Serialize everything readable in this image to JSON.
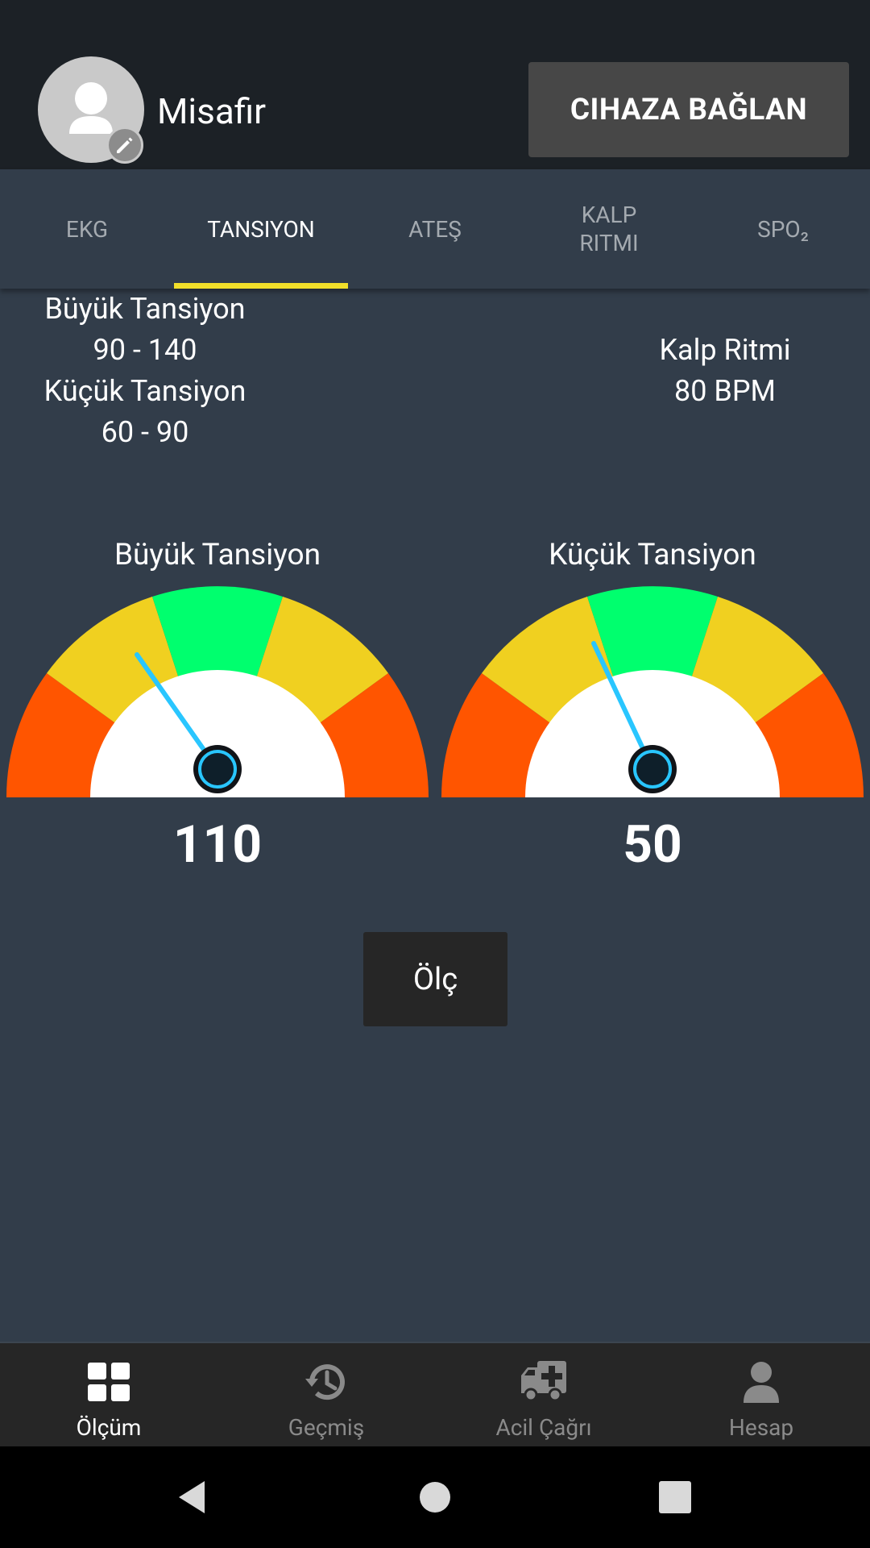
{
  "header": {
    "username": "Misafir",
    "connect_button": "CIHAZA BAĞLAN"
  },
  "tabs": [
    {
      "label": "EKG",
      "active": false
    },
    {
      "label": "TANSIYON",
      "active": true
    },
    {
      "label": "ATEŞ",
      "active": false
    },
    {
      "label": "KALP\nRITMI",
      "active": false
    },
    {
      "label": "SPO₂",
      "active": false
    }
  ],
  "reference": {
    "systolic_label": "Büyük Tansiyon",
    "systolic_range": "90 - 140",
    "diastolic_label": "Küçük Tansiyon",
    "diastolic_range": "60 - 90",
    "heart_rate_label": "Kalp Ritmi",
    "heart_rate_value": "80 BPM"
  },
  "gauges": [
    {
      "title": "Büyük Tansiyon",
      "value": "110"
    },
    {
      "title": "Küçük Tansiyon",
      "value": "50"
    }
  ],
  "measure_button": "Ölç",
  "bottom_nav": [
    {
      "label": "Ölçüm",
      "icon": "dashboard-icon",
      "active": true
    },
    {
      "label": "Geçmiş",
      "icon": "history-icon",
      "active": false
    },
    {
      "label": "Acil Çağrı",
      "icon": "ambulance-icon",
      "active": false
    },
    {
      "label": "Hesap",
      "icon": "person-icon",
      "active": false
    }
  ],
  "colors": {
    "header_bg": "#1c2126",
    "body_bg": "#323d4a",
    "tab_indicator": "#f1df2a",
    "gauge_red": "#ff5500",
    "gauge_yellow": "#f0d020",
    "gauge_green": "#00ff6e",
    "needle": "#29c6ff"
  }
}
